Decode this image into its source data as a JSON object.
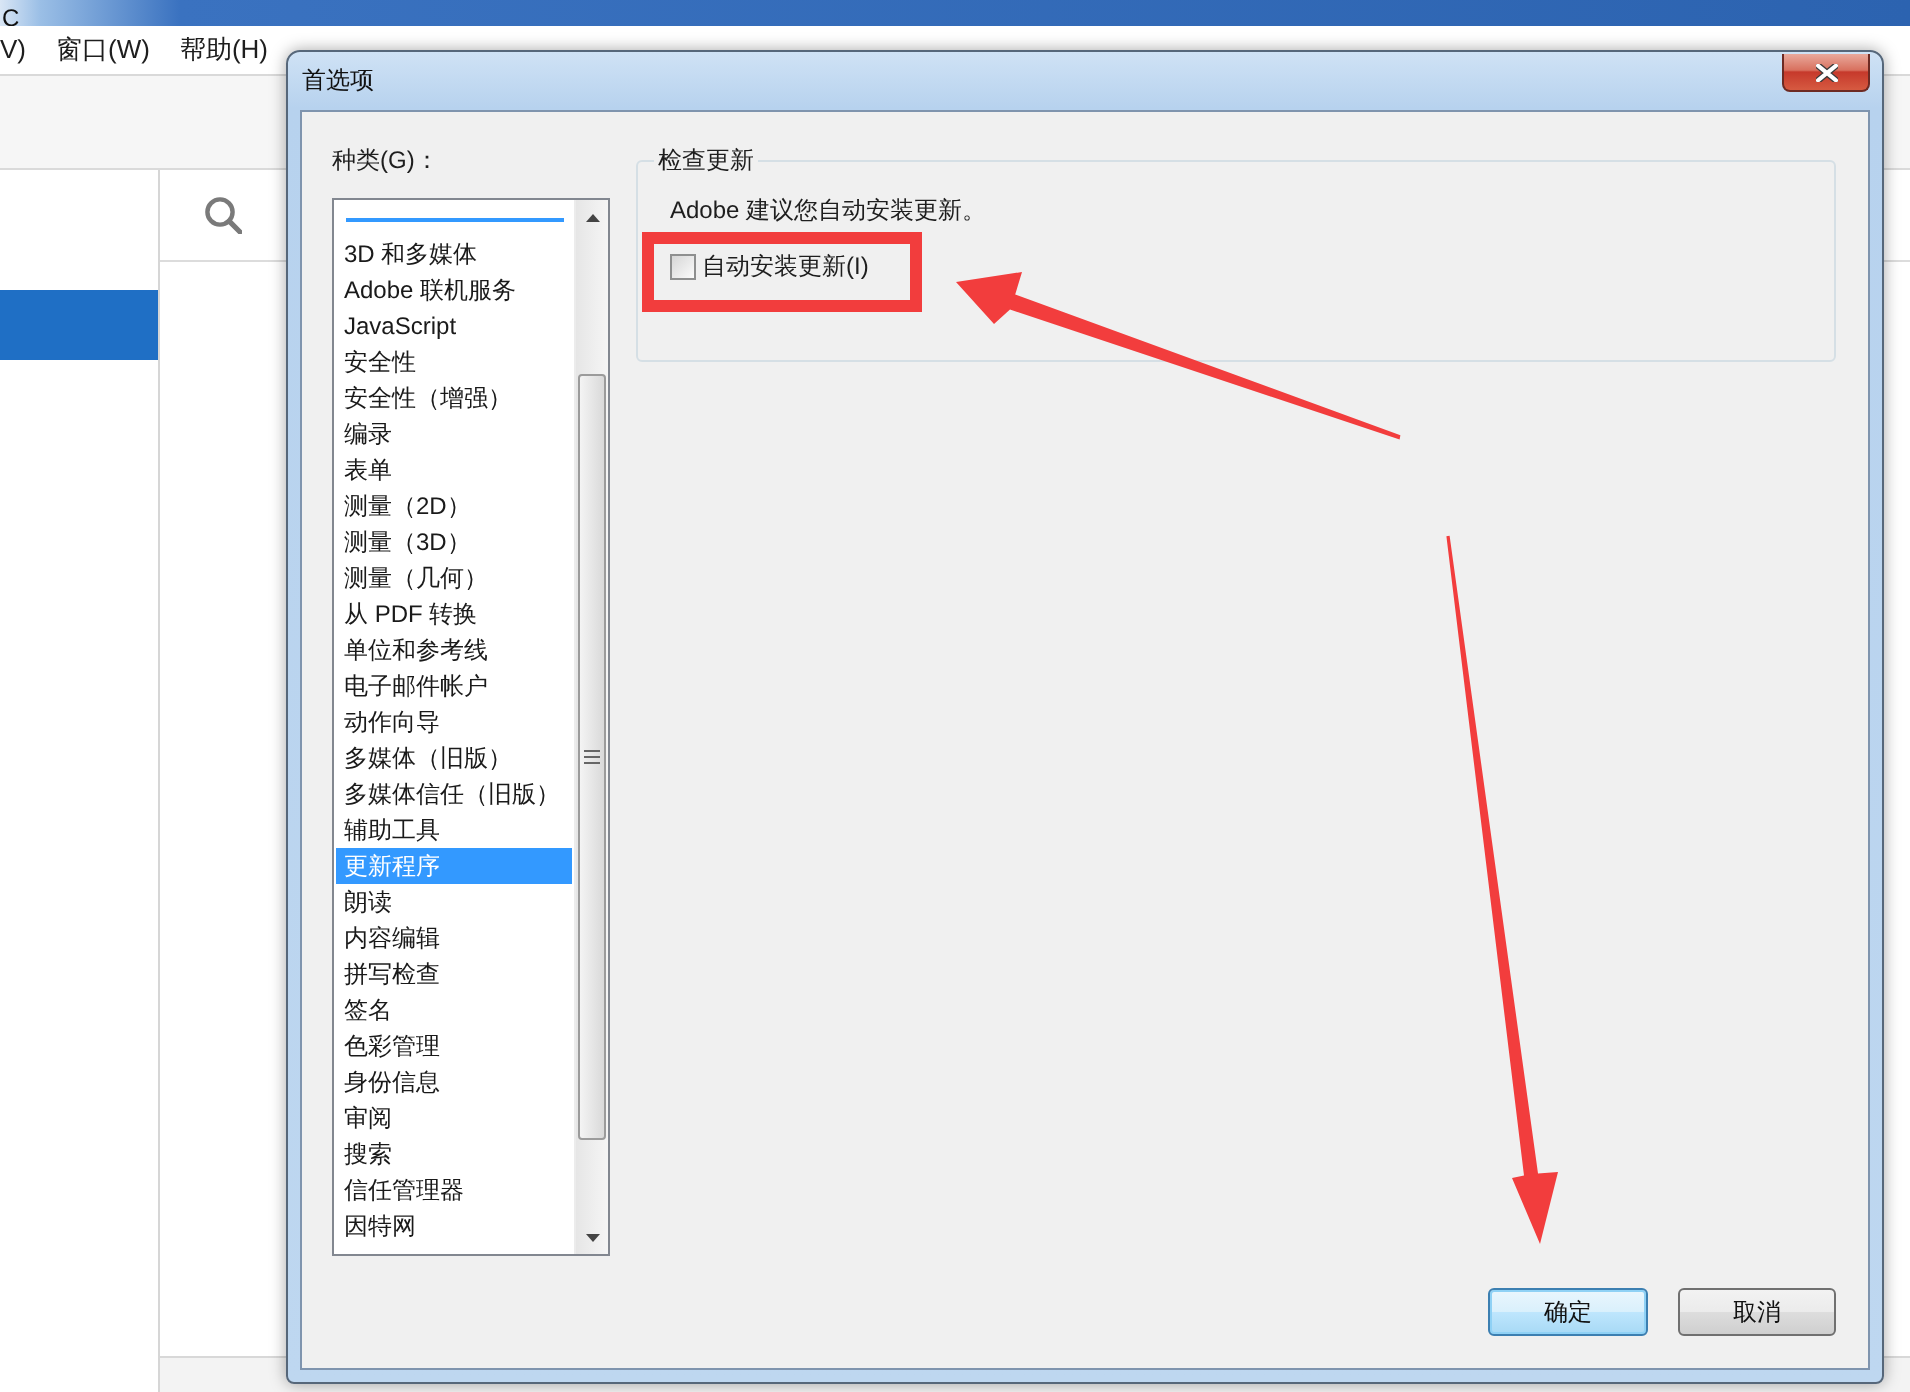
{
  "app": {
    "title": "C",
    "menu": [
      "V)",
      "窗口(W)",
      "帮助(H)"
    ]
  },
  "dialog": {
    "title": "首选项",
    "category_label": "种类(G)：",
    "categories": [
      {
        "label": "3D 和多媒体",
        "selected": false
      },
      {
        "label": "Adobe 联机服务",
        "selected": false
      },
      {
        "label": "JavaScript",
        "selected": false
      },
      {
        "label": "安全性",
        "selected": false
      },
      {
        "label": "安全性（增强）",
        "selected": false
      },
      {
        "label": "编录",
        "selected": false
      },
      {
        "label": "表单",
        "selected": false
      },
      {
        "label": "测量（2D）",
        "selected": false
      },
      {
        "label": "测量（3D）",
        "selected": false
      },
      {
        "label": "测量（几何）",
        "selected": false
      },
      {
        "label": "从 PDF 转换",
        "selected": false
      },
      {
        "label": "单位和参考线",
        "selected": false
      },
      {
        "label": "电子邮件帐户",
        "selected": false
      },
      {
        "label": "动作向导",
        "selected": false
      },
      {
        "label": "多媒体（旧版）",
        "selected": false
      },
      {
        "label": "多媒体信任（旧版）",
        "selected": false
      },
      {
        "label": "辅助工具",
        "selected": false
      },
      {
        "label": "更新程序",
        "selected": true
      },
      {
        "label": "朗读",
        "selected": false
      },
      {
        "label": "内容编辑",
        "selected": false
      },
      {
        "label": "拼写检查",
        "selected": false
      },
      {
        "label": "签名",
        "selected": false
      },
      {
        "label": "色彩管理",
        "selected": false
      },
      {
        "label": "身份信息",
        "selected": false
      },
      {
        "label": "审阅",
        "selected": false
      },
      {
        "label": "搜索",
        "selected": false
      },
      {
        "label": "信任管理器",
        "selected": false
      },
      {
        "label": "因特网",
        "selected": false
      }
    ],
    "panel": {
      "title": "检查更新",
      "message": "Adobe 建议您自动安装更新。",
      "checkbox": {
        "label": "自动安装更新(I)",
        "checked": false
      }
    },
    "buttons": [
      {
        "label": "确定",
        "default": true
      },
      {
        "label": "取消",
        "default": false
      }
    ]
  }
}
